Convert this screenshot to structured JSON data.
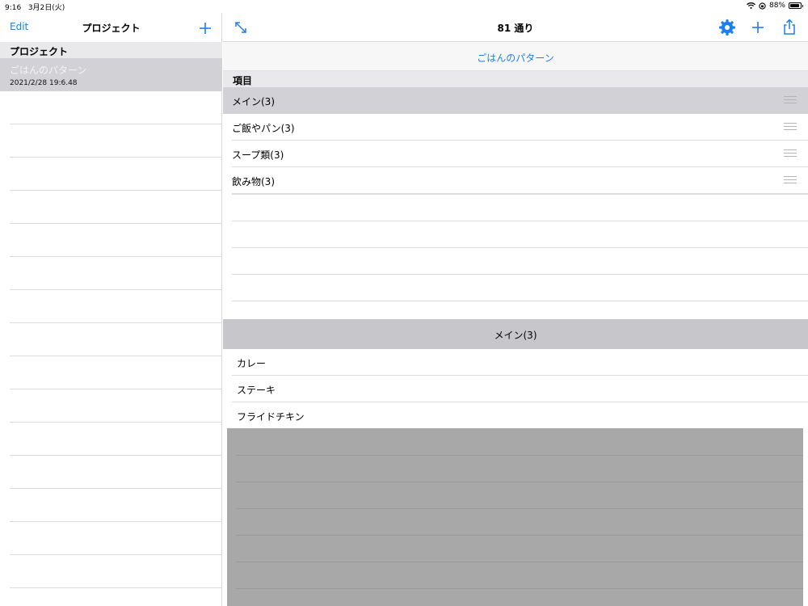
{
  "status_bar": {
    "time": "9:16",
    "date": "3月2日(火)",
    "battery": "88%",
    "battery_level": 0.88
  },
  "left_pane": {
    "edit_label": "Edit",
    "title": "プロジェクト",
    "section_header": "プロジェクト",
    "projects": [
      {
        "name": "ごはんのパターン",
        "date": "2021/2/28 19:6.48",
        "selected": true
      }
    ]
  },
  "right_pane": {
    "title": "81 通り",
    "pattern_name": "ごはんのパターン",
    "items_header": "項目",
    "items": [
      {
        "label": "メイン(3)",
        "selected": true
      },
      {
        "label": "ご飯やパン(3)",
        "selected": false
      },
      {
        "label": "スープ類(3)",
        "selected": false
      },
      {
        "label": "飲み物(3)",
        "selected": false
      }
    ],
    "detail_header": "メイン(3)",
    "detail_items": [
      "カレー",
      "ステーキ",
      "フライドチキン"
    ]
  },
  "icons": {
    "expand": "expand-arrows-icon",
    "settings": "gear-icon",
    "add": "plus-icon",
    "share": "share-icon",
    "reorder": "drag-handle-icon",
    "wifi": "wifi-icon",
    "lock": "rotation-lock-icon",
    "battery": "battery-icon"
  },
  "colors": {
    "accent": "#1c7ff0",
    "selected_row": "#d1d1d6",
    "section_bg": "#e9e9eb",
    "detail_header_bg": "#c7c7cb",
    "overlay_grey": "#a8a8a8"
  }
}
